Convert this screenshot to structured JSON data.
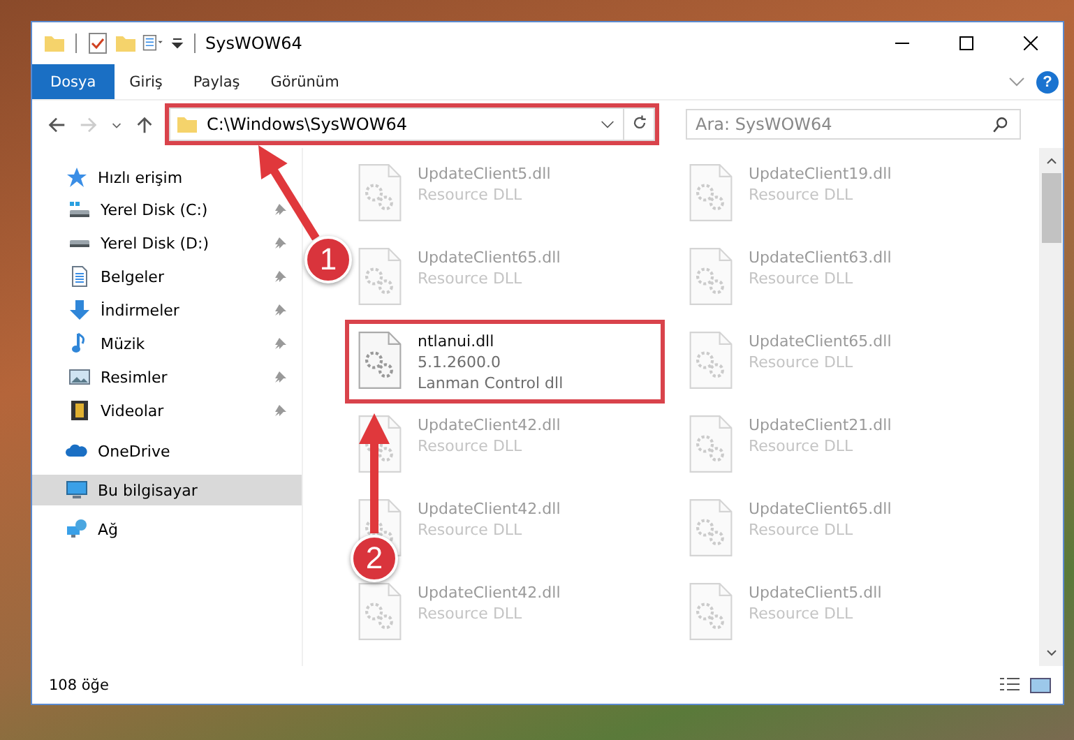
{
  "window": {
    "title": "SysWOW64"
  },
  "ribbon_tabs": [
    {
      "label": "Dosya",
      "kind": "file"
    },
    {
      "label": "Giriş",
      "kind": "tab"
    },
    {
      "label": "Paylaş",
      "kind": "tab"
    },
    {
      "label": "Görünüm",
      "kind": "tab"
    }
  ],
  "address_bar": {
    "path": "C:\\Windows\\SysWOW64",
    "highlighted": true
  },
  "search": {
    "placeholder": "Ara: SysWOW64"
  },
  "sidebar": {
    "items": [
      {
        "label": "Hızlı erişim",
        "kind": "star",
        "selected": false,
        "children": [
          {
            "label": "Yerel Disk (C:)",
            "kind": "drive-win",
            "pinned": true
          },
          {
            "label": "Yerel Disk (D:)",
            "kind": "drive",
            "pinned": true
          },
          {
            "label": "Belgeler",
            "kind": "doc",
            "pinned": true
          },
          {
            "label": "İndirmeler",
            "kind": "download",
            "pinned": true
          },
          {
            "label": "Müzik",
            "kind": "music",
            "pinned": true
          },
          {
            "label": "Resimler",
            "kind": "picture",
            "pinned": true
          },
          {
            "label": "Videolar",
            "kind": "video",
            "pinned": true
          }
        ]
      },
      {
        "label": "OneDrive",
        "kind": "cloud",
        "selected": false
      },
      {
        "label": "Bu bilgisayar",
        "kind": "pc",
        "selected": true
      },
      {
        "label": "Ağ",
        "kind": "network",
        "selected": false
      }
    ]
  },
  "files": [
    {
      "name": "UpdateClient5.dll",
      "details": [
        "Resource DLL"
      ],
      "dimmed": true,
      "highlighted": false
    },
    {
      "name": "UpdateClient19.dll",
      "details": [
        "Resource DLL"
      ],
      "dimmed": true,
      "highlighted": false
    },
    {
      "name": "UpdateClient65.dll",
      "details": [
        "Resource DLL"
      ],
      "dimmed": true,
      "highlighted": false
    },
    {
      "name": "UpdateClient63.dll",
      "details": [
        "Resource DLL"
      ],
      "dimmed": true,
      "highlighted": false
    },
    {
      "name": "ntlanui.dll",
      "details": [
        "5.1.2600.0",
        "Lanman Control dll"
      ],
      "dimmed": false,
      "highlighted": true
    },
    {
      "name": "UpdateClient65.dll",
      "details": [
        "Resource DLL"
      ],
      "dimmed": true,
      "highlighted": false
    },
    {
      "name": "UpdateClient42.dll",
      "details": [
        "Resource DLL"
      ],
      "dimmed": true,
      "highlighted": false
    },
    {
      "name": "UpdateClient21.dll",
      "details": [
        "Resource DLL"
      ],
      "dimmed": true,
      "highlighted": false
    },
    {
      "name": "UpdateClient42.dll",
      "details": [
        "Resource DLL"
      ],
      "dimmed": true,
      "highlighted": false
    },
    {
      "name": "UpdateClient65.dll",
      "details": [
        "Resource DLL"
      ],
      "dimmed": true,
      "highlighted": false
    },
    {
      "name": "UpdateClient42.dll",
      "details": [
        "Resource DLL"
      ],
      "dimmed": true,
      "highlighted": false
    },
    {
      "name": "UpdateClient5.dll",
      "details": [
        "Resource DLL"
      ],
      "dimmed": true,
      "highlighted": false
    }
  ],
  "status_bar": {
    "item_count": "108 öğe"
  },
  "help_button": {
    "label": "?"
  },
  "annotations": [
    {
      "number": "1",
      "kind": "diagonal"
    },
    {
      "number": "2",
      "kind": "vertical"
    }
  ]
}
